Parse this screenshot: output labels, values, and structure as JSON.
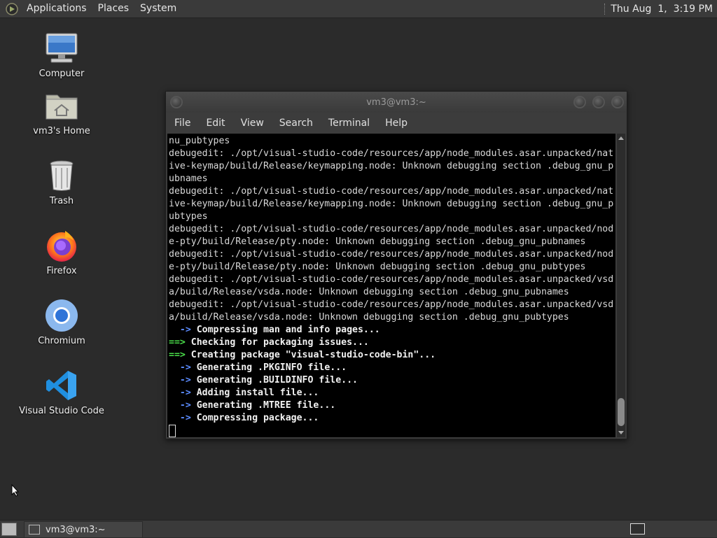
{
  "top_panel": {
    "menus": [
      "Applications",
      "Places",
      "System"
    ],
    "clock": "Thu Aug  1,  3:19 PM"
  },
  "desktop_icons": [
    {
      "label": "Computer",
      "icon": "computer-icon"
    },
    {
      "label": "vm3's Home",
      "icon": "home-folder-icon"
    },
    {
      "label": "Trash",
      "icon": "trash-icon"
    },
    {
      "label": "Firefox",
      "icon": "firefox-icon"
    },
    {
      "label": "Chromium",
      "icon": "chromium-icon"
    },
    {
      "label": "Visual Studio Code",
      "icon": "vscode-icon"
    }
  ],
  "terminal": {
    "title": "vm3@vm3:~",
    "menu": [
      "File",
      "Edit",
      "View",
      "Search",
      "Terminal",
      "Help"
    ],
    "lines": [
      {
        "t": "nu_pubtypes",
        "s": "n"
      },
      {
        "t": "debugedit: ./opt/visual-studio-code/resources/app/node_modules.asar.unpacked/nat",
        "s": "n"
      },
      {
        "t": "ive-keymap/build/Release/keymapping.node: Unknown debugging section .debug_gnu_p",
        "s": "n"
      },
      {
        "t": "ubnames",
        "s": "n"
      },
      {
        "t": "debugedit: ./opt/visual-studio-code/resources/app/node_modules.asar.unpacked/nat",
        "s": "n"
      },
      {
        "t": "ive-keymap/build/Release/keymapping.node: Unknown debugging section .debug_gnu_p",
        "s": "n"
      },
      {
        "t": "ubtypes",
        "s": "n"
      },
      {
        "t": "debugedit: ./opt/visual-studio-code/resources/app/node_modules.asar.unpacked/nod",
        "s": "n"
      },
      {
        "t": "e-pty/build/Release/pty.node: Unknown debugging section .debug_gnu_pubnames",
        "s": "n"
      },
      {
        "t": "debugedit: ./opt/visual-studio-code/resources/app/node_modules.asar.unpacked/nod",
        "s": "n"
      },
      {
        "t": "e-pty/build/Release/pty.node: Unknown debugging section .debug_gnu_pubtypes",
        "s": "n"
      },
      {
        "t": "debugedit: ./opt/visual-studio-code/resources/app/node_modules.asar.unpacked/vsd",
        "s": "n"
      },
      {
        "t": "a/build/Release/vsda.node: Unknown debugging section .debug_gnu_pubnames",
        "s": "n"
      },
      {
        "t": "debugedit: ./opt/visual-studio-code/resources/app/node_modules.asar.unpacked/vsd",
        "s": "n"
      },
      {
        "t": "a/build/Release/vsda.node: Unknown debugging section .debug_gnu_pubtypes",
        "s": "n"
      },
      {
        "p": "  ->",
        "t": " Compressing man and info pages...",
        "s": "arrow"
      },
      {
        "p": "==>",
        "t": " Checking for packaging issues...",
        "s": "big"
      },
      {
        "p": "==>",
        "t": " Creating package \"visual-studio-code-bin\"...",
        "s": "big"
      },
      {
        "p": "  ->",
        "t": " Generating .PKGINFO file...",
        "s": "arrow"
      },
      {
        "p": "  ->",
        "t": " Generating .BUILDINFO file...",
        "s": "arrow"
      },
      {
        "p": "  ->",
        "t": " Adding install file...",
        "s": "arrow"
      },
      {
        "p": "  ->",
        "t": " Generating .MTREE file...",
        "s": "arrow"
      },
      {
        "p": "  ->",
        "t": " Compressing package...",
        "s": "arrow"
      }
    ]
  },
  "taskbar": {
    "window_button": "vm3@vm3:~"
  },
  "colors": {
    "desktop_bg": "#2b2b2b",
    "panel_bg": "#3a3a3a",
    "terminal_bg": "#000000",
    "arrow_prompt": "#5b8cff",
    "big_prompt": "#4ade4a"
  }
}
